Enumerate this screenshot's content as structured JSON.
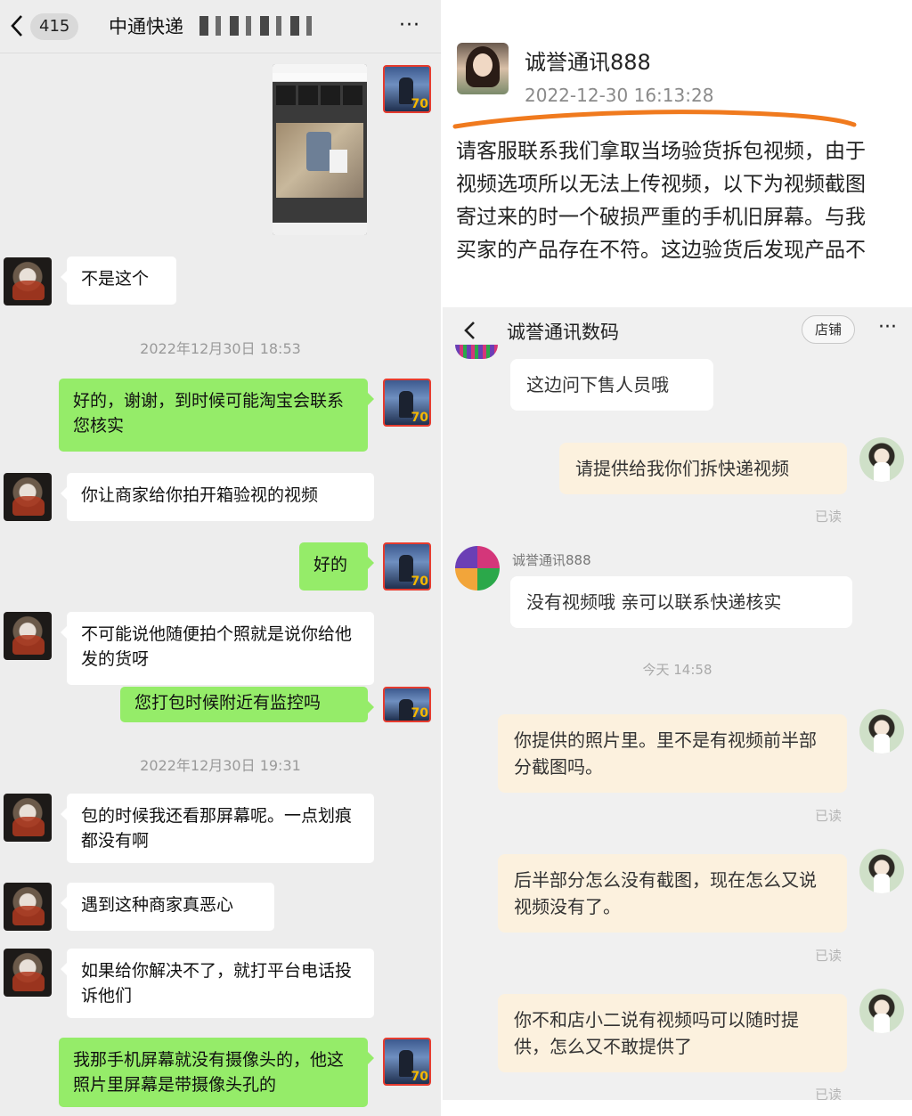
{
  "wechat": {
    "unread_count": "415",
    "chat_title": "中通快递",
    "more_label": "···",
    "messages": [
      {
        "text": "不是这个"
      },
      {
        "text": "好的，谢谢，到时候可能淘宝会联系您核实"
      },
      {
        "text": "你让商家给你拍开箱验视的视频"
      },
      {
        "text": "好的"
      },
      {
        "text": "不可能说他随便拍个照就是说你给他发的货呀"
      },
      {
        "text": "您打包时候附近有监控吗"
      },
      {
        "text": "包的时候我还看那屏幕呢。一点划痕都没有啊"
      },
      {
        "text": "遇到这种商家真恶心"
      },
      {
        "text": "如果给你解决不了，就打平台电话投诉他们"
      },
      {
        "text": "我那手机屏幕就没有摄像头的，他这照片里屏幕是带摄像头孔的"
      }
    ],
    "timestamps": [
      "2022年12月30日 18:53",
      "2022年12月30日 19:31"
    ]
  },
  "post": {
    "author": "诚誉通讯888",
    "time": "2022-12-30 16:13:28",
    "lines": [
      "请客服联系我们拿取当场验货拆包视频，由于",
      "视频选项所以无法上传视频，以下为视频截图",
      "寄过来的时一个破损严重的手机旧屏幕。与我",
      "买家的产品存在不符。这边验货后发现产品不"
    ]
  },
  "taobao": {
    "title": "诚誉通讯数码",
    "shop_button": "店铺",
    "more_label": "···",
    "sender_name": "诚誉通讯888",
    "time_label": "今天  14:58",
    "read_label": "已读",
    "messages": [
      {
        "text": "这边问下售人员哦"
      },
      {
        "text": "请提供给我你们拆快递视频"
      },
      {
        "text": "没有视频哦  亲可以联系快递核实"
      },
      {
        "text": "你提供的照片里。里不是有视频前半部分截图吗。"
      },
      {
        "text": "后半部分怎么没有截图，现在怎么又说视频没有了。"
      },
      {
        "text": "你不和店小二说有视频吗可以随时提供，怎么又不敢提供了"
      }
    ]
  },
  "colors": {
    "wechat_green": "#95ec69",
    "wechat_bg": "#ededed",
    "taobao_cream": "#fcf1de",
    "post_underline": "#f07a1e"
  }
}
